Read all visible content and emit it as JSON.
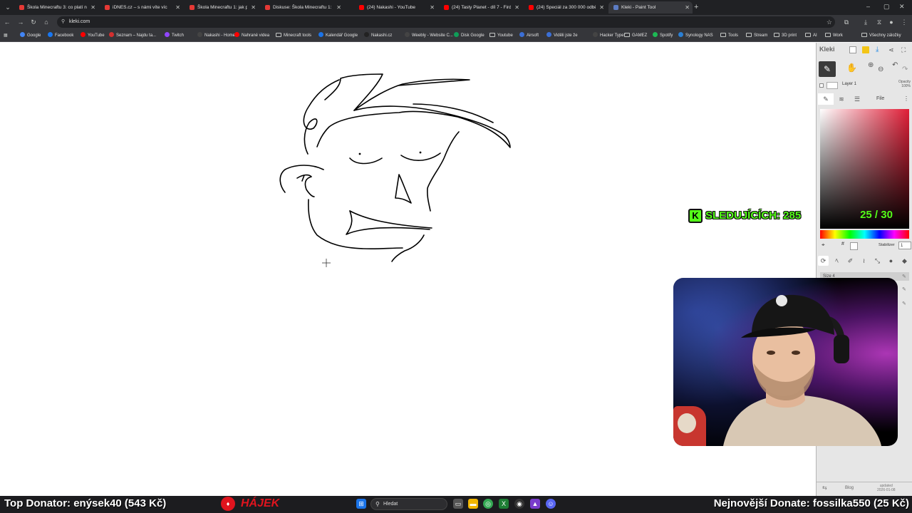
{
  "browser": {
    "tabs": [
      {
        "title": "Škola Minecraftu 3: co platí na",
        "color": "#e53935",
        "active": false
      },
      {
        "title": "iDNES.cz – s námi víte víc",
        "color": "#e53935",
        "active": false
      },
      {
        "title": "Škola Minecraftu 1: jak přežít p",
        "color": "#e53935",
        "active": false
      },
      {
        "title": "Diskuse: Škola Minecraftu 1: jak",
        "color": "#e53935",
        "active": false
      },
      {
        "title": "(24) Nakashi - YouTube",
        "color": "#ff0000",
        "active": false
      },
      {
        "title": "(24) Tasty Planet - díl 7 - Firdin",
        "color": "#ff0000",
        "active": false
      },
      {
        "title": "(24) Speciál za 300 000 odběra",
        "color": "#ff0000",
        "active": false
      },
      {
        "title": "Kleki - Paint Tool",
        "color": "#5c7cc4",
        "active": true
      }
    ],
    "url": "kleki.com",
    "bookmarks": [
      {
        "label": "Google",
        "color": "#4285f4"
      },
      {
        "label": "Facebook",
        "color": "#1877f2"
      },
      {
        "label": "YouTube",
        "color": "#ff0000"
      },
      {
        "label": "Seznam – Najdu ta...",
        "color": "#d32f2f"
      },
      {
        "label": "Twitch",
        "color": "#9146ff"
      },
      {
        "label": "Nakashi - Home",
        "color": "#444444"
      },
      {
        "label": "Nahrané videa",
        "color": "#ff0000"
      },
      {
        "label": "Minecraft tools",
        "folder": true
      },
      {
        "label": "Kalendář Google",
        "color": "#1a73e8"
      },
      {
        "label": "Nakashi.cz",
        "color": "#222222"
      },
      {
        "label": "Weebly - Website C...",
        "color": "#444444"
      },
      {
        "label": "Disk Google",
        "color": "#0f9d58"
      },
      {
        "label": "Youtube",
        "folder": true
      },
      {
        "label": "Airsoft",
        "color": "#3b6fd6"
      },
      {
        "label": "Viděli jste že",
        "color": "#3b6fd6"
      },
      {
        "label": "Hacker Typer",
        "color": "#444444"
      },
      {
        "label": "GAMEZ",
        "folder": true
      },
      {
        "label": "Spotify",
        "color": "#1db954"
      },
      {
        "label": "Synology NAS",
        "color": "#2a7fd4"
      },
      {
        "label": "Tools",
        "folder": true
      },
      {
        "label": "Stream",
        "folder": true
      },
      {
        "label": "3D print",
        "folder": true
      },
      {
        "label": "AI",
        "folder": true
      },
      {
        "label": "Work",
        "folder": true
      },
      {
        "label": "Všechny záložky",
        "folder": true
      }
    ]
  },
  "kleki": {
    "logo": "Kleki",
    "layer_name": "Layer 1",
    "opacity_label": "Opacity",
    "opacity_value": "100%",
    "file_tab": "File",
    "stabilizer_label": "Stabilizer",
    "stabilizer_value": "1",
    "hash": "#",
    "size_label": "Size 4",
    "blog": "Blog",
    "updated_label": "updated",
    "updated_date": "2026-01-08",
    "main_color": "#e01e37"
  },
  "overlay": {
    "followers": "SLEDUJÍCÍCH: 285",
    "follower_badge": "K",
    "counter": "25 / 30",
    "accent": "#53fc18"
  },
  "bottom": {
    "top_donator": "Top Donator: enýsek40  (543 Kč)",
    "sponsor": "HÁJEK",
    "latest_donate": "Nejnovější Donate: fossilka550 (25 Kč)",
    "search_placeholder": "Hledat"
  }
}
